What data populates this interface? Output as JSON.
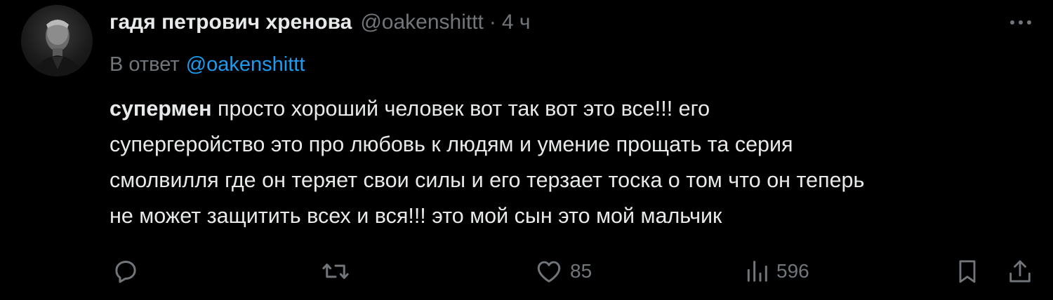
{
  "tweet": {
    "display_name": "гадя петрович хренова",
    "handle": "@oakenshittt",
    "separator": "·",
    "time": "4 ч",
    "reply_prefix": "В ответ",
    "reply_to": "@oakenshittt",
    "body_lead": "супермен",
    "body_lines": [
      " просто хороший человек вот так вот это все!!! его",
      "супергеройство это про любовь к людям и умение прощать та серия",
      "смолвилля где он теряет свои силы и его терзает тоска о том что он теперь",
      "не может защитить всех и вся!!! это мой сын это мой мальчик"
    ]
  },
  "actions": {
    "reply_icon": "reply-icon",
    "retweet_icon": "retweet-icon",
    "like_icon": "heart-icon",
    "like_count": "85",
    "views_icon": "views-icon",
    "views_count": "596",
    "bookmark_icon": "bookmark-icon",
    "share_icon": "share-icon"
  },
  "colors": {
    "background": "#000000",
    "text_primary": "#e7e9ea",
    "text_secondary": "#71767b",
    "accent": "#1d9bf0"
  }
}
